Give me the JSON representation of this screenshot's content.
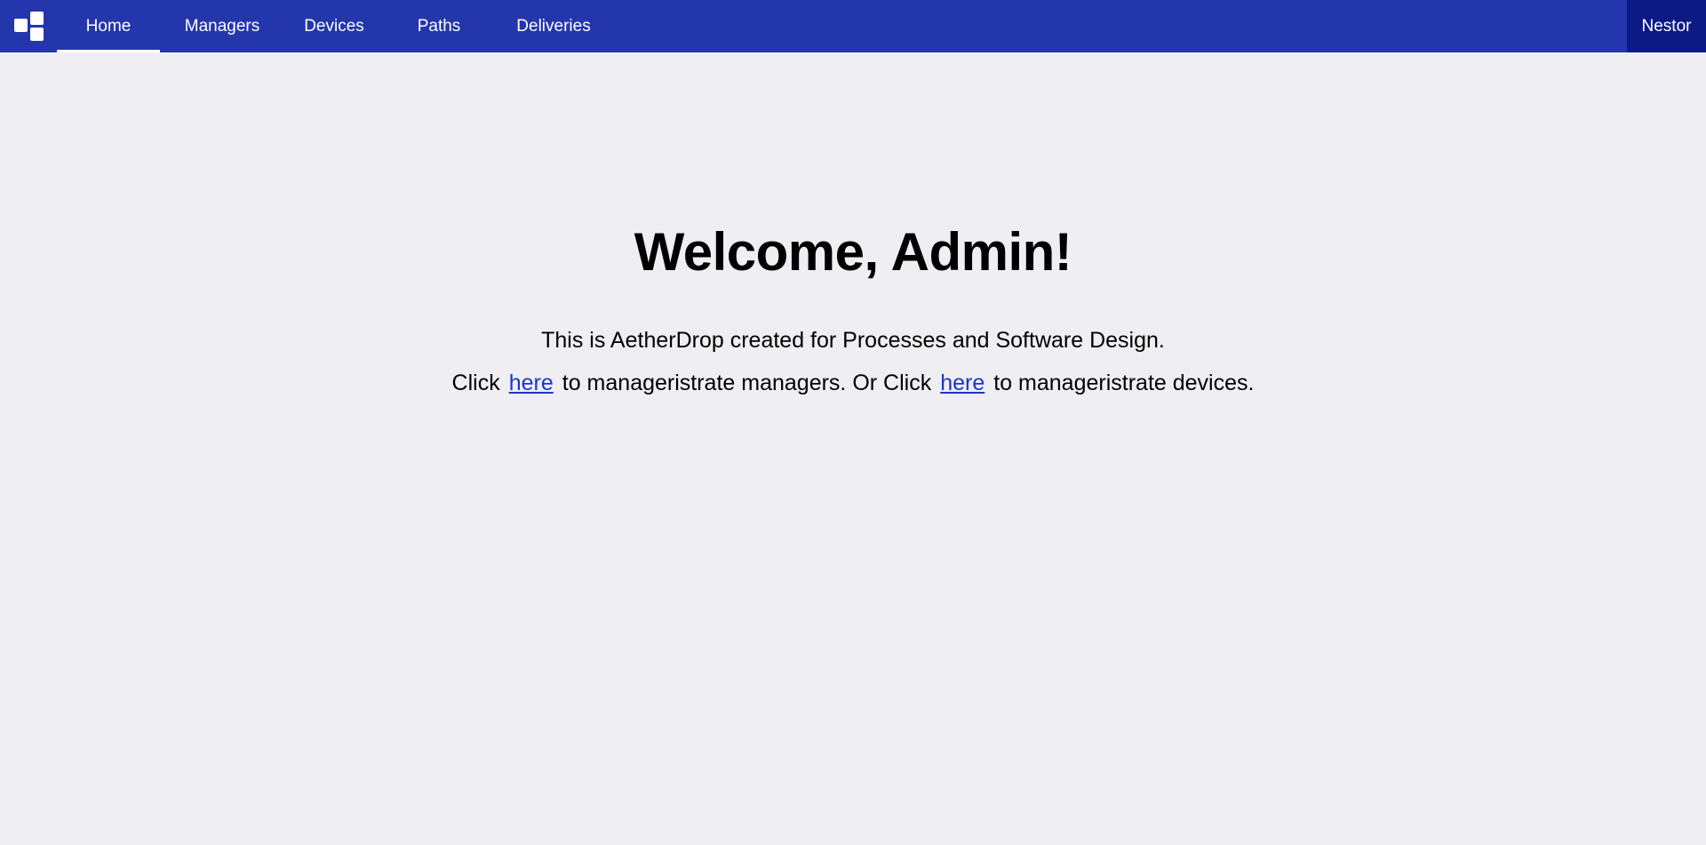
{
  "nav": {
    "items": [
      {
        "label": "Home",
        "active": true
      },
      {
        "label": "Managers",
        "active": false
      },
      {
        "label": "Devices",
        "active": false
      },
      {
        "label": "Paths",
        "active": false
      },
      {
        "label": "Deliveries",
        "active": false
      }
    ],
    "user": "Nestor"
  },
  "main": {
    "heading": "Welcome, Admin!",
    "intro": "This is AetherDrop created for Processes and Software Design.",
    "line2": {
      "part1": "Click",
      "link1": "here",
      "part2": "to manageristrate managers. Or Click",
      "link2": "here",
      "part3": "to manageristrate devices."
    }
  },
  "colors": {
    "navbar": "#2436ac",
    "user_bg": "#0d1a85",
    "background": "#efeff3",
    "link": "#1c35c8"
  }
}
